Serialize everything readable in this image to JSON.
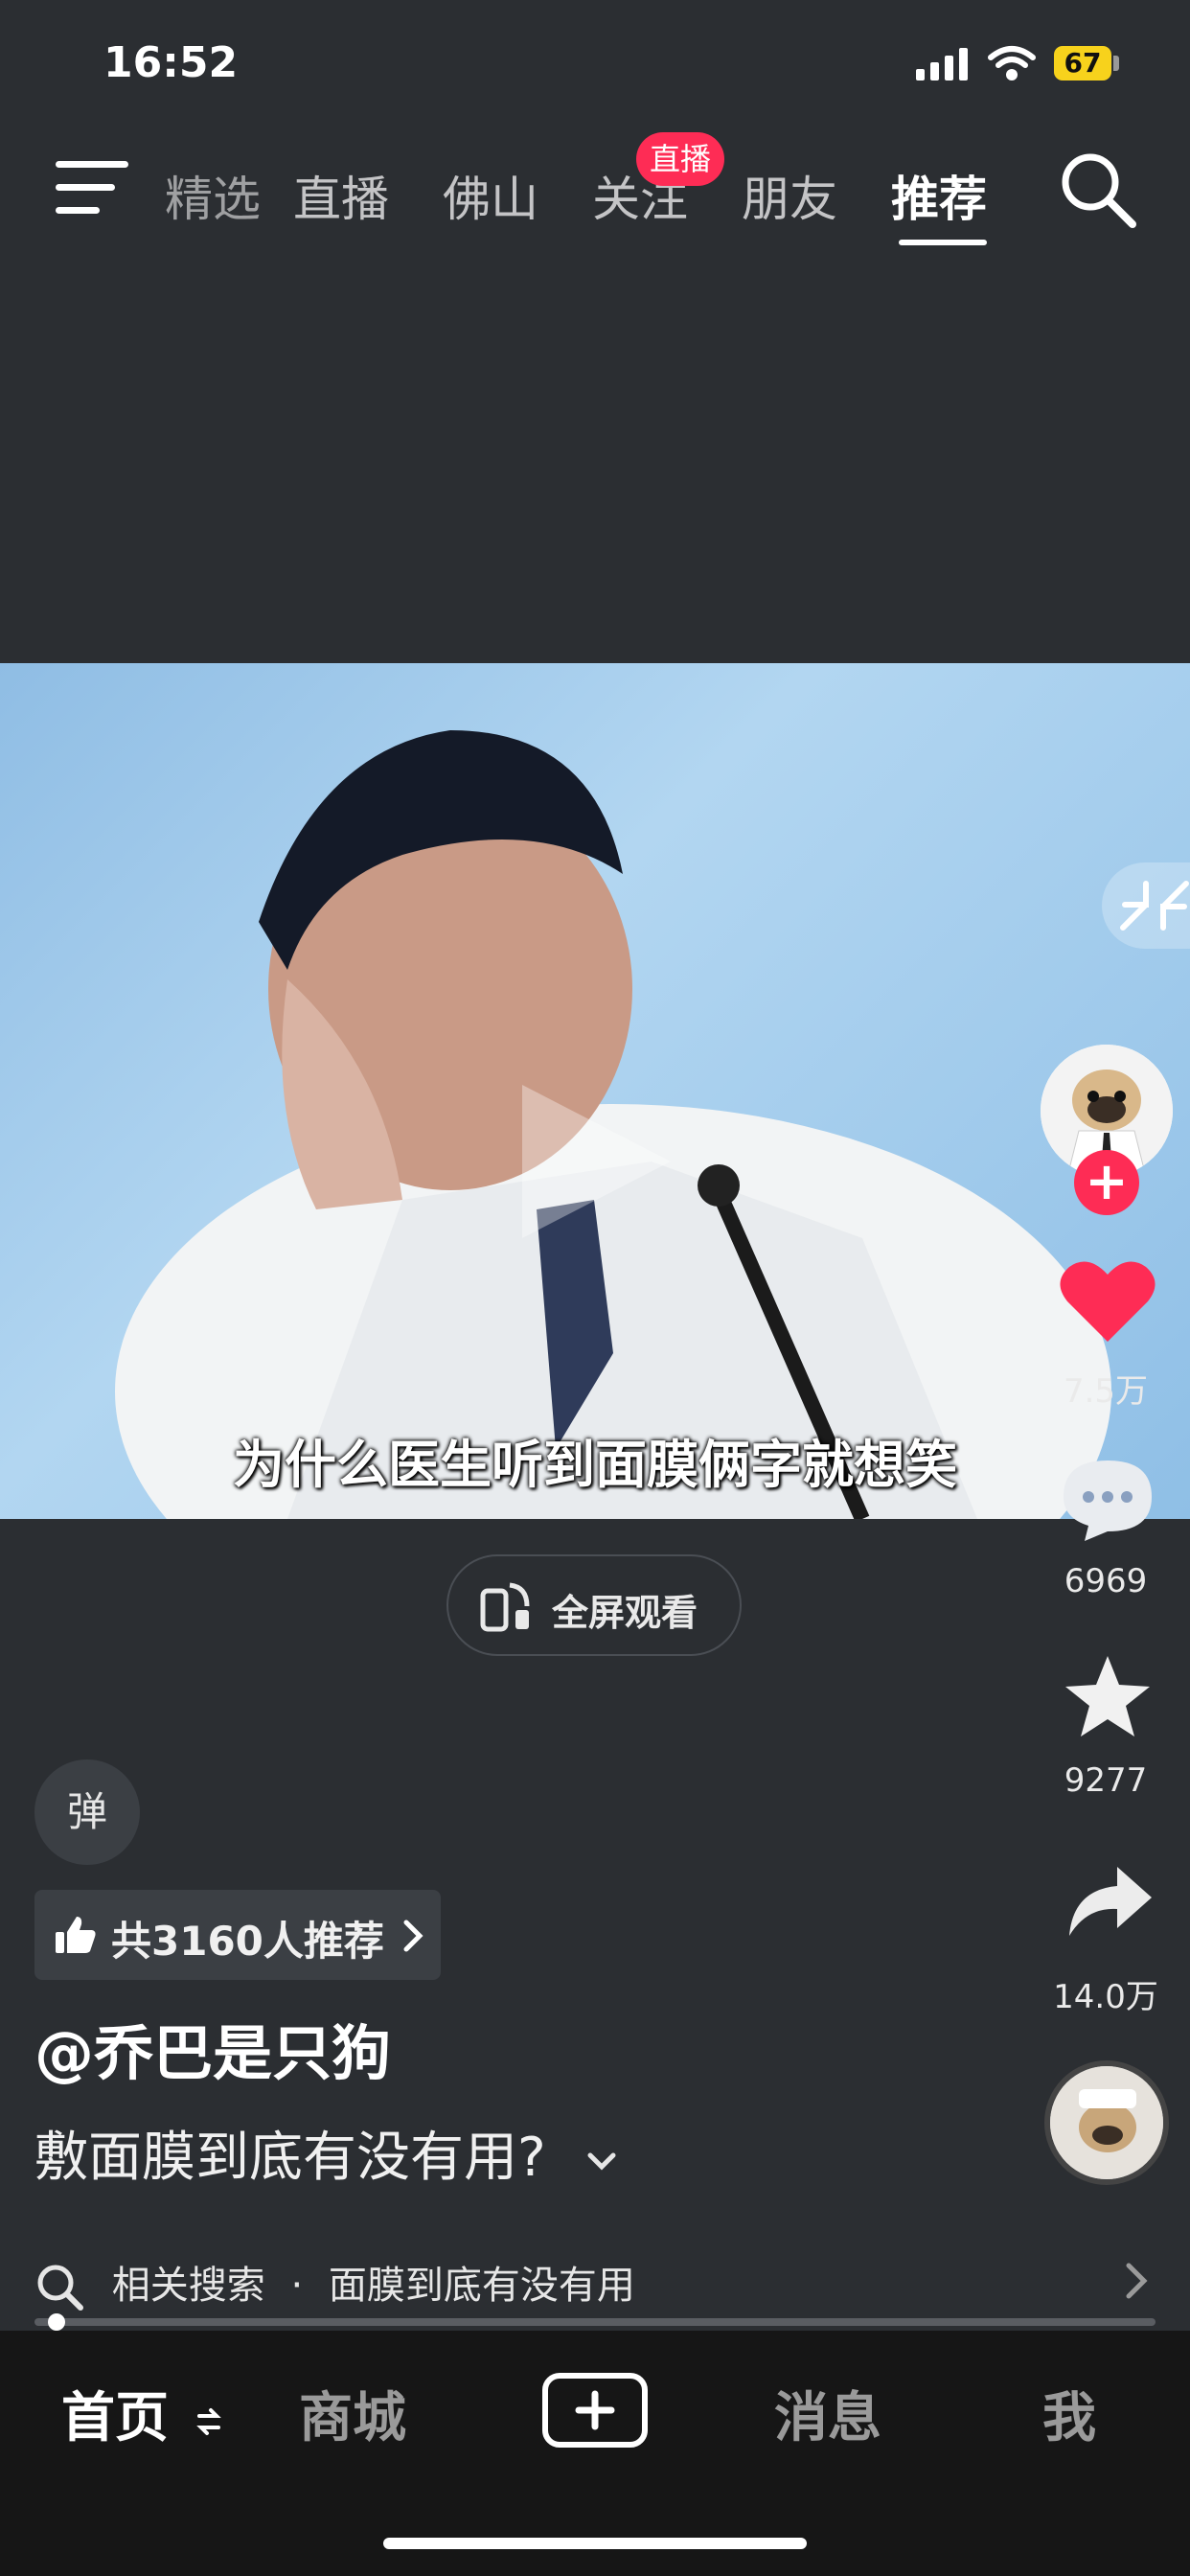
{
  "status_bar": {
    "time": "16:52",
    "battery": "67"
  },
  "top_nav": {
    "tabs": [
      {
        "label": "精选"
      },
      {
        "label": "直播"
      },
      {
        "label": "佛山"
      },
      {
        "label": "关注"
      },
      {
        "label": "朋友"
      },
      {
        "label": "推荐"
      }
    ],
    "live_badge": "直播",
    "active_tab": "推荐"
  },
  "video": {
    "subtitle": "为什么医生听到面膜俩字就想笑"
  },
  "fullscreen_button": {
    "label": "全屏观看"
  },
  "danmaku_button": {
    "label": "弹"
  },
  "recommend": {
    "text": "共3160人推荐"
  },
  "post": {
    "author": "@乔巴是只狗",
    "description": "敷面膜到底有没有用?"
  },
  "related_search": {
    "prefix": "相关搜索",
    "separator": "·",
    "query": "面膜到底有没有用"
  },
  "progress": 0.01,
  "side_actions": {
    "likes": "7.5万",
    "comments": "6969",
    "favorites": "9277",
    "shares": "14.0万"
  },
  "bottom_nav": {
    "items": [
      {
        "label": "首页"
      },
      {
        "label": "商城"
      },
      {
        "label": "消息"
      },
      {
        "label": "我"
      }
    ]
  },
  "colors": {
    "accent": "#fe2c55",
    "background": "#2b2e32",
    "bottom_bar": "#161616",
    "battery": "#f7d21c"
  }
}
